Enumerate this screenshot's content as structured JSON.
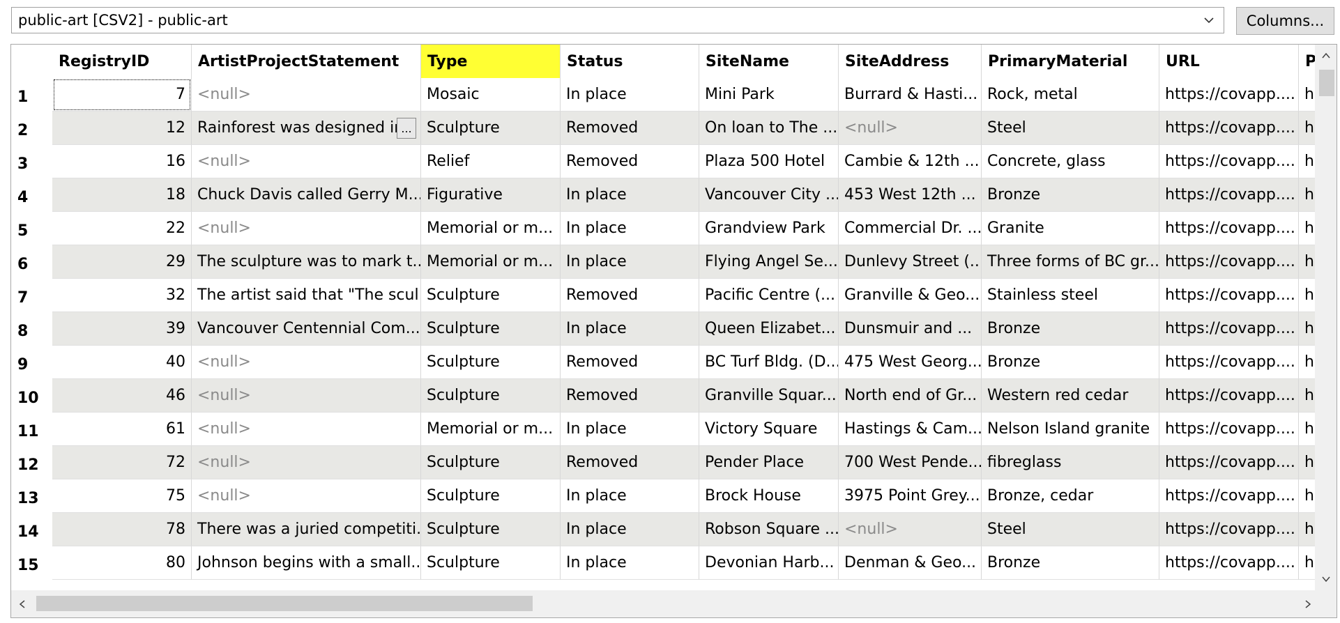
{
  "toolbar": {
    "layer_select_value": "public-art [CSV2] - public-art",
    "columns_button": "Columns..."
  },
  "table": {
    "highlighted_column": "Type",
    "columns": [
      "RegistryID",
      "ArtistProjectStatement",
      "Type",
      "Status",
      "SiteName",
      "SiteAddress",
      "PrimaryMaterial",
      "URL",
      "P"
    ],
    "null_text": "<null>",
    "expand_button": "...",
    "rows": [
      {
        "num": "1",
        "cells": [
          "7",
          "<null>",
          "Mosaic",
          "In place",
          "Mini Park",
          "Burrard & Hasti...",
          "Rock, metal",
          "https://covapp....",
          "h"
        ]
      },
      {
        "num": "2",
        "cells": [
          "12",
          "Rainforest was designed in",
          "Sculpture",
          "Removed",
          "On loan to The ...",
          "<null>",
          "Steel",
          "https://covapp....",
          "h"
        ]
      },
      {
        "num": "3",
        "cells": [
          "16",
          "<null>",
          "Relief",
          "Removed",
          "Plaza 500 Hotel",
          "Cambie & 12th ...",
          "Concrete, glass",
          "https://covapp....",
          "h"
        ]
      },
      {
        "num": "4",
        "cells": [
          "18",
          "Chuck Davis called Gerry M...",
          "Figurative",
          "In place",
          "Vancouver City ...",
          "453 West 12th ...",
          "Bronze",
          "https://covapp....",
          "h"
        ]
      },
      {
        "num": "5",
        "cells": [
          "22",
          "<null>",
          "Memorial or m...",
          "In place",
          "Grandview Park",
          "Commercial Dr. ...",
          "Granite",
          "https://covapp....",
          "h"
        ]
      },
      {
        "num": "6",
        "cells": [
          "29",
          "The sculpture was to mark t...",
          "Memorial or m...",
          "In place",
          "Flying Angel Se...",
          "Dunlevy Street (...",
          "Three forms of BC gr...",
          "https://covapp....",
          "h"
        ]
      },
      {
        "num": "7",
        "cells": [
          "32",
          "The artist said that \"The scul...",
          "Sculpture",
          "Removed",
          "Pacific Centre (...",
          "Granville & Geo...",
          "Stainless steel",
          "https://covapp....",
          "h"
        ]
      },
      {
        "num": "8",
        "cells": [
          "39",
          "Vancouver Centennial Com...",
          "Sculpture",
          "In place",
          "Queen Elizabet...",
          "Dunsmuir and ...",
          "Bronze",
          "https://covapp....",
          "h"
        ]
      },
      {
        "num": "9",
        "cells": [
          "40",
          "<null>",
          "Sculpture",
          "Removed",
          "BC Turf Bldg. (D...",
          "475 West Georg...",
          "Bronze",
          "https://covapp....",
          "h"
        ]
      },
      {
        "num": "10",
        "cells": [
          "46",
          "<null>",
          "Sculpture",
          "Removed",
          "Granville Squar...",
          "North end of Gr...",
          "Western red cedar",
          "https://covapp....",
          "h"
        ]
      },
      {
        "num": "11",
        "cells": [
          "61",
          "<null>",
          "Memorial or m...",
          "In place",
          "Victory Square",
          "Hastings & Cam...",
          "Nelson Island granite",
          "https://covapp....",
          "h"
        ]
      },
      {
        "num": "12",
        "cells": [
          "72",
          "<null>",
          "Sculpture",
          "Removed",
          "Pender Place",
          "700 West Pende...",
          "fibreglass",
          "https://covapp....",
          "h"
        ]
      },
      {
        "num": "13",
        "cells": [
          "75",
          "<null>",
          "Sculpture",
          "In place",
          "Brock House",
          "3975 Point Grey...",
          "Bronze, cedar",
          "https://covapp....",
          "h"
        ]
      },
      {
        "num": "14",
        "cells": [
          "78",
          "There was a juried competiti...",
          "Sculpture",
          "In place",
          "Robson Square ...",
          "<null>",
          "Steel",
          "https://covapp....",
          "h"
        ]
      },
      {
        "num": "15",
        "cells": [
          "80",
          "Johnson begins with a small...",
          "Sculpture",
          "In place",
          "Devonian Harb...",
          "Denman & Geo...",
          "Bronze",
          "https://covapp....",
          "h"
        ]
      }
    ]
  },
  "icons": {
    "dropdown": "chevron-down-icon",
    "scroll_up": "arrow-up-icon",
    "scroll_down": "arrow-down-icon",
    "scroll_left": "arrow-left-icon",
    "scroll_right": "arrow-right-icon"
  },
  "colors": {
    "highlight": "#ffff33",
    "alt_row": "#e8e8e5",
    "null_text": "#8a8a8a"
  }
}
